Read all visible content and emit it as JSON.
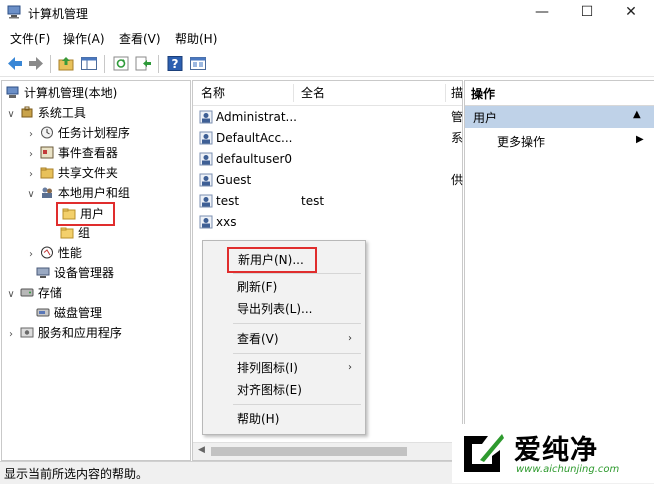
{
  "window": {
    "title": "计算机管理",
    "controls": [
      "minimize-icon",
      "maximize-icon",
      "close-icon"
    ]
  },
  "menu": [
    "文件(F)",
    "操作(A)",
    "查看(V)",
    "帮助(H)"
  ],
  "toolbar": {
    "icons": [
      "back-arrow-icon",
      "forward-arrow-icon",
      "up-folder-icon",
      "show-hide-tree-icon",
      "refresh-icon",
      "export-list-icon",
      "help-icon",
      "properties-icon"
    ]
  },
  "tree": {
    "root": "计算机管理(本地)",
    "system_tools": "系统工具",
    "task_scheduler": "任务计划程序",
    "event_viewer": "事件查看器",
    "shared_folders": "共享文件夹",
    "local_users_groups": "本地用户和组",
    "users": "用户",
    "groups": "组",
    "performance": "性能",
    "device_manager": "设备管理器",
    "storage": "存储",
    "disk_management": "磁盘管理",
    "services_apps": "服务和应用程序"
  },
  "list": {
    "columns": [
      "名称",
      "全名",
      "描"
    ],
    "rows": [
      {
        "name": "Administrat...",
        "fullname": "",
        "desc": "管"
      },
      {
        "name": "DefaultAcc...",
        "fullname": "",
        "desc": "系"
      },
      {
        "name": "defaultuser0",
        "fullname": "",
        "desc": ""
      },
      {
        "name": "Guest",
        "fullname": "",
        "desc": "供"
      },
      {
        "name": "test",
        "fullname": "test",
        "desc": ""
      },
      {
        "name": "xxs",
        "fullname": "",
        "desc": ""
      }
    ]
  },
  "context_menu": {
    "new_user": "新用户(N)...",
    "refresh": "刷新(F)",
    "export_list": "导出列表(L)...",
    "view": "查看(V)",
    "arrange_icons": "排列图标(I)",
    "align_icons": "对齐图标(E)",
    "help": "帮助(H)"
  },
  "actions": {
    "header": "操作",
    "section": "用户",
    "more": "更多操作"
  },
  "status": "显示当前所选内容的帮助。",
  "watermark": {
    "brand": "爱纯净",
    "url": "www.aichunjing.com"
  },
  "colors": {
    "highlight": "#e02d2d",
    "action_section_bg": "#bfd2e8",
    "tree_selected_bg": "#cce4f7"
  }
}
